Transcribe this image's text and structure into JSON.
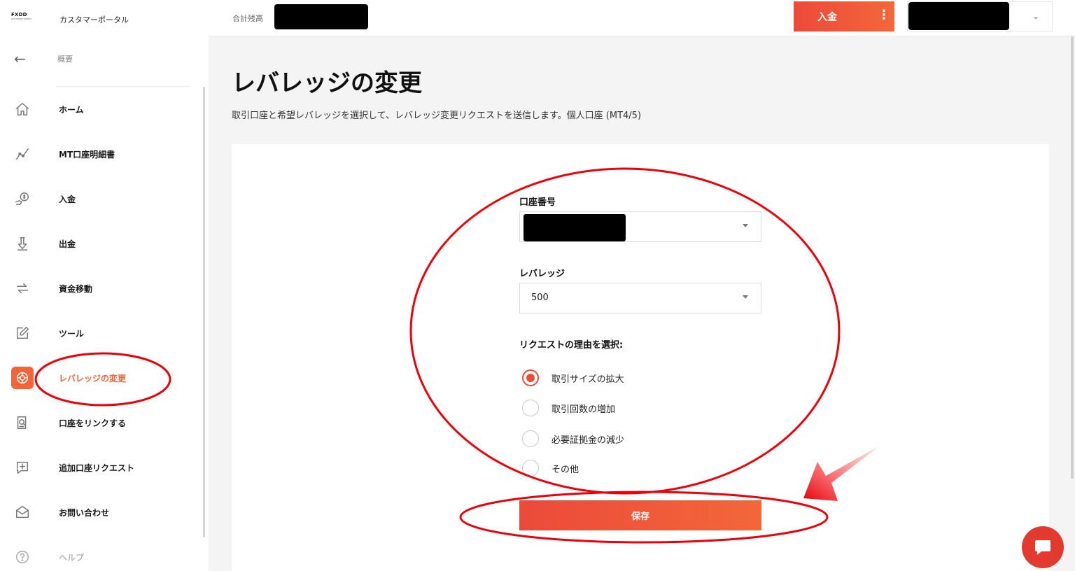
{
  "logo": {
    "brand": "FXDD",
    "sub": "CUSTOMER PORTAL"
  },
  "sidebar": {
    "portal_name": "カスタマーポータル",
    "back_label": "概要",
    "items": [
      {
        "label": "ホーム",
        "icon": "home-icon"
      },
      {
        "label": "MT口座明細書",
        "icon": "chart-line-icon"
      },
      {
        "label": "入金",
        "icon": "deposit-icon"
      },
      {
        "label": "出金",
        "icon": "withdraw-icon"
      },
      {
        "label": "資金移動",
        "icon": "transfer-icon"
      },
      {
        "label": "ツール",
        "icon": "edit-icon"
      },
      {
        "label": "レバレッジの変更",
        "icon": "lifebuoy-icon",
        "active": true
      },
      {
        "label": "口座をリンクする",
        "icon": "link-doc-icon"
      },
      {
        "label": "追加口座リクエスト",
        "icon": "add-chat-icon"
      },
      {
        "label": "お問い合わせ",
        "icon": "mail-icon"
      },
      {
        "label": "ヘルプ",
        "icon": "help-icon"
      }
    ]
  },
  "header": {
    "balance_label": "合計残高",
    "deposit_label": "入金",
    "kebab": "⋮",
    "chevron": "⌄"
  },
  "main": {
    "title": "レバレッジの変更",
    "description": "取引口座と希望レバレッジを選択して、レバレッジ変更リクエストを送信します。個人口座 (MT4/5)",
    "account_label": "口座番号",
    "leverage_label": "レバレッジ",
    "leverage_value": "500",
    "reason_label": "リクエストの理由を選択:",
    "reasons": [
      {
        "label": "取引サイズの拡大",
        "selected": true
      },
      {
        "label": "取引回数の増加",
        "selected": false
      },
      {
        "label": "必要証拠金の減少",
        "selected": false
      },
      {
        "label": "その他",
        "selected": false
      }
    ],
    "save_label": "保存"
  },
  "colors": {
    "accent": "#ec4a3a",
    "annotation": "#e8000a"
  }
}
